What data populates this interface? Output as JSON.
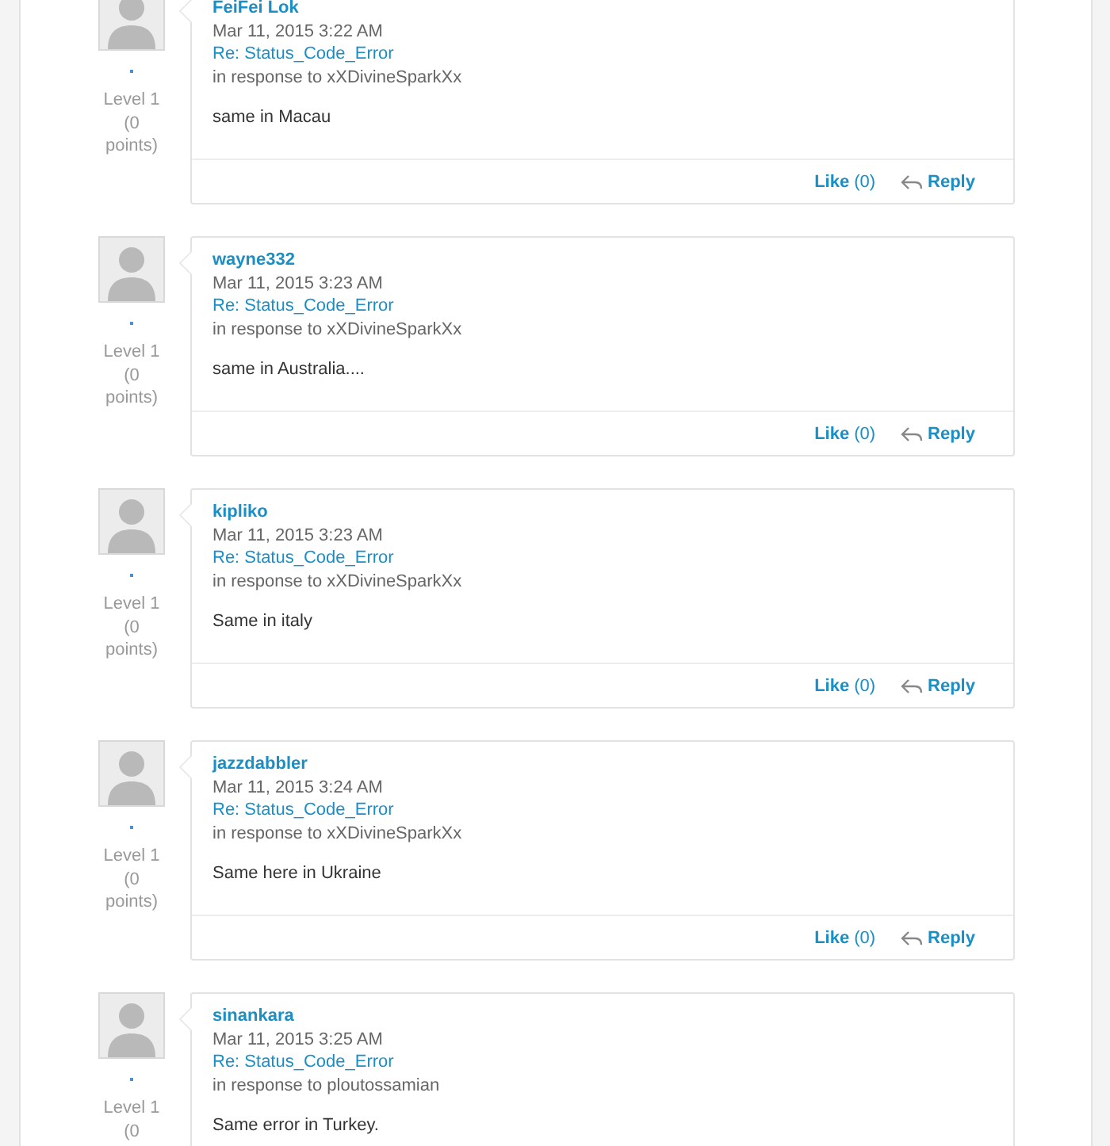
{
  "posts": [
    {
      "author": "FeiFei Lok",
      "date": "Mar 11, 2015 3:22 AM",
      "subject": "Re: Status_Code_Error",
      "in_response": "in response to xXDivineSparkXx",
      "body": "same in Macau",
      "level": "Level 1",
      "points": "(0 points)",
      "like": "Like",
      "like_count": "(0)",
      "reply": "Reply"
    },
    {
      "author": "wayne332",
      "date": "Mar 11, 2015 3:23 AM",
      "subject": "Re: Status_Code_Error",
      "in_response": "in response to xXDivineSparkXx",
      "body": "same in Australia....",
      "level": "Level 1",
      "points": "(0 points)",
      "like": "Like",
      "like_count": "(0)",
      "reply": "Reply"
    },
    {
      "author": "kipliko",
      "date": "Mar 11, 2015 3:23 AM",
      "subject": "Re: Status_Code_Error",
      "in_response": "in response to xXDivineSparkXx",
      "body": "Same in italy",
      "level": "Level 1",
      "points": "(0 points)",
      "like": "Like",
      "like_count": "(0)",
      "reply": "Reply"
    },
    {
      "author": "jazzdabbler",
      "date": "Mar 11, 2015 3:24 AM",
      "subject": "Re: Status_Code_Error",
      "in_response": "in response to xXDivineSparkXx",
      "body": "Same here in Ukraine",
      "level": "Level 1",
      "points": "(0 points)",
      "like": "Like",
      "like_count": "(0)",
      "reply": "Reply"
    },
    {
      "author": "sinankara",
      "date": "Mar 11, 2015 3:25 AM",
      "subject": "Re: Status_Code_Error",
      "in_response": "in response to ploutossamian",
      "body": "Same error in Turkey.",
      "level": "Level 1",
      "points": "(0"
    }
  ]
}
